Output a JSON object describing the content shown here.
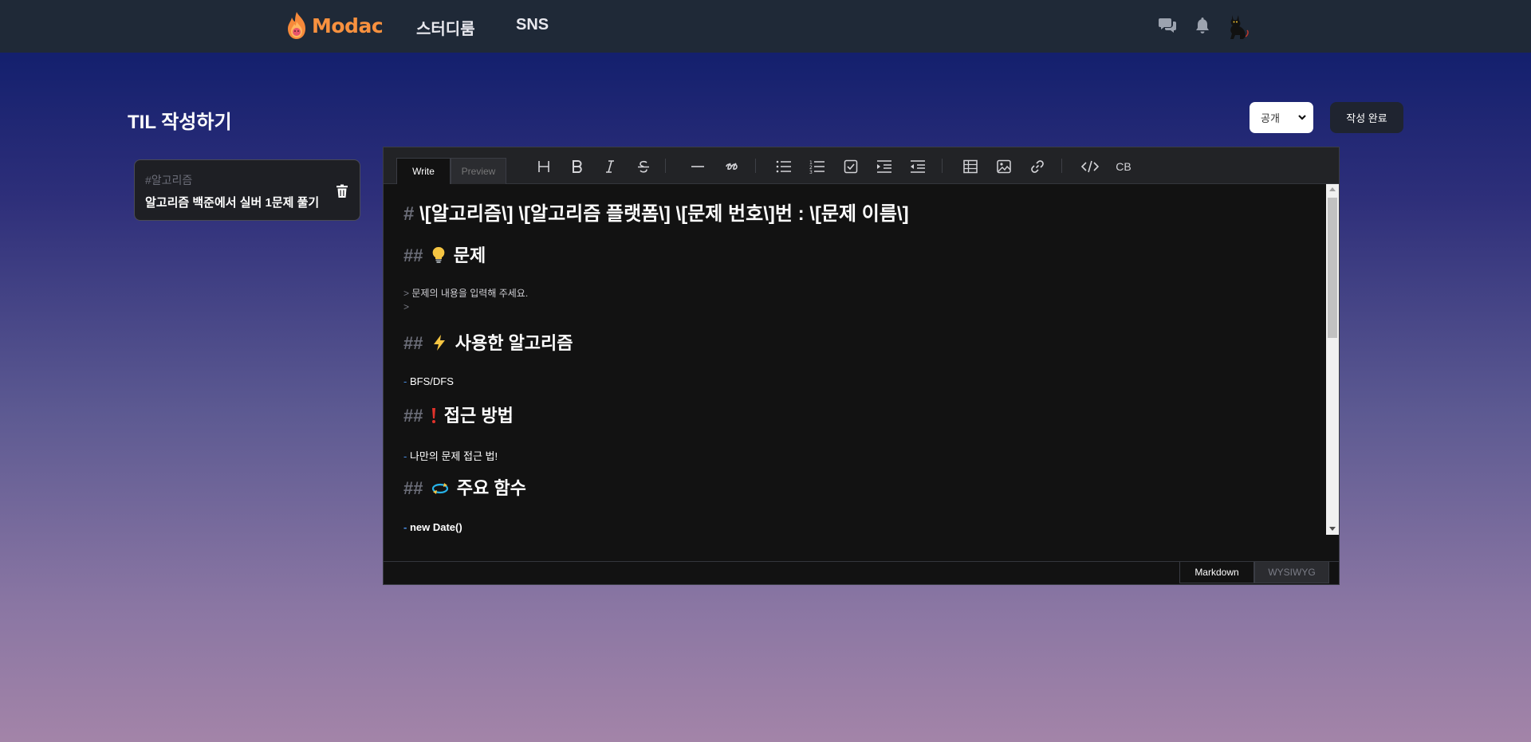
{
  "header": {
    "logo_text": "Modac",
    "nav": [
      {
        "label": "스터디룸"
      },
      {
        "label": "SNS"
      }
    ],
    "icons": [
      "chat-icon",
      "bell-icon",
      "avatar"
    ]
  },
  "page": {
    "title": "TIL 작성하기",
    "visibility": {
      "selected": "공개"
    },
    "submit_label": "작성 완료"
  },
  "til_card": {
    "tag": "#알고리즘",
    "title": "알고리즘 백준에서 실버 1문제 풀기"
  },
  "editor": {
    "tabs": {
      "write": "Write",
      "preview": "Preview"
    },
    "toolbar": [
      "heading-icon",
      "bold-icon",
      "italic-icon",
      "strike-icon",
      "hr-icon",
      "quote-icon",
      "bullet-list-icon",
      "ordered-list-icon",
      "task-list-icon",
      "indent-icon",
      "outdent-icon",
      "table-icon",
      "image-icon",
      "link-icon",
      "code-icon",
      "codeblock-icon"
    ],
    "codeblock_label": "CB",
    "lines": {
      "h1_mark": "#",
      "h1_text": "\\[알고리즘\\] \\[알고리즘 플랫폼\\] \\[문제 번호\\]번 : \\[문제 이름\\]",
      "h2_mark": "##",
      "problem": "문제",
      "quote_mark": ">",
      "quote_text": "문제의 내용을 입력해 주세요.",
      "algo": "사용한 알고리즘",
      "list_dash": "-",
      "algo_item": "BFS/DFS",
      "approach": "접근 방법",
      "approach_item": "나만의 문제 접근 법!",
      "funcs": "주요 함수",
      "funcs_item": "new Date()"
    },
    "modes": {
      "markdown": "Markdown",
      "wysiwyg": "WYSIWYG"
    }
  },
  "colors": {
    "header_bg": "#1f2937",
    "logo": "#f8913f",
    "editor_bg": "#121212",
    "list_dash": "#4a8fe6"
  }
}
